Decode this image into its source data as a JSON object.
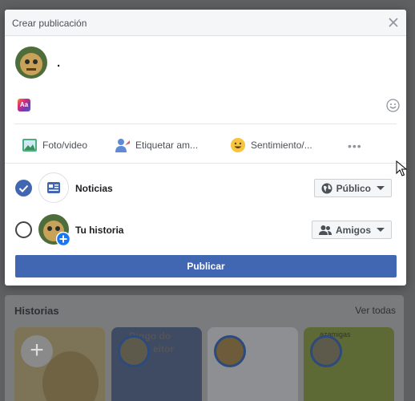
{
  "modal": {
    "title": "Crear publicación",
    "composer_text": "."
  },
  "actions": {
    "photo": "Foto/video",
    "tag": "Etiquetar am...",
    "feeling": "Sentimiento/..."
  },
  "share": {
    "news_label": "Noticias",
    "news_checked": true,
    "news_audience": "Público",
    "story_label": "Tu historia",
    "story_checked": false,
    "story_audience": "Amigos"
  },
  "publish_label": "Publicar",
  "background": {
    "stories_title": "Historias",
    "see_all": "Ver todas",
    "story_texts": [
      "Bingo do",
      "eitor",
      "azamigas"
    ]
  },
  "colors": {
    "accent": "#4267b2",
    "header_bg": "#f5f6f7"
  }
}
